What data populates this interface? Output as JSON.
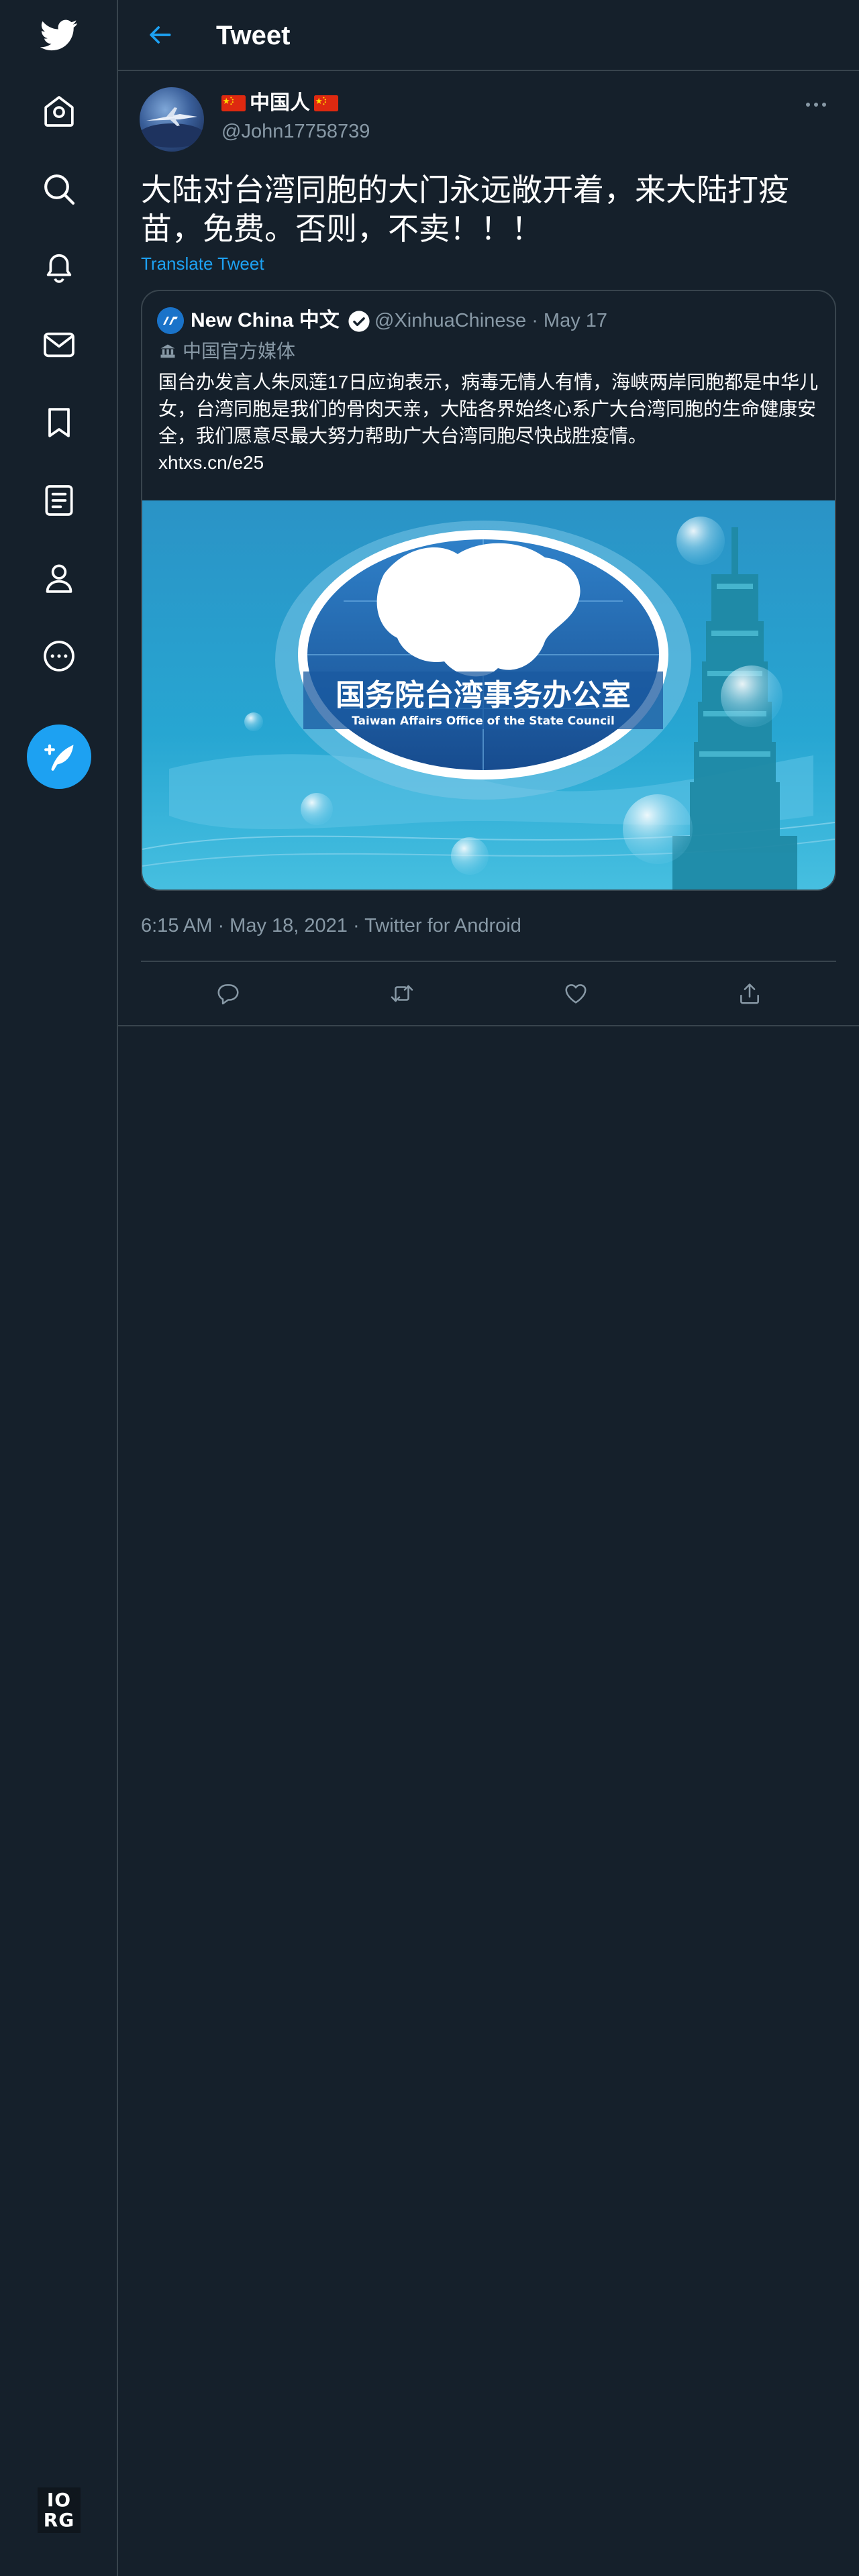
{
  "colors": {
    "background": "#15202b",
    "border": "#38444d",
    "accent": "#1da1f2",
    "secondary_text": "#8899a6",
    "primary_text": "#ffffff"
  },
  "nav": {
    "items": [
      {
        "name": "twitter-logo",
        "icon": "twitter-bird-icon"
      },
      {
        "name": "home",
        "icon": "home-icon"
      },
      {
        "name": "explore",
        "icon": "search-icon"
      },
      {
        "name": "notifications",
        "icon": "bell-icon"
      },
      {
        "name": "messages",
        "icon": "mail-icon"
      },
      {
        "name": "bookmarks",
        "icon": "bookmark-icon"
      },
      {
        "name": "lists",
        "icon": "list-icon"
      },
      {
        "name": "profile",
        "icon": "person-icon"
      },
      {
        "name": "more",
        "icon": "more-circle-icon"
      }
    ],
    "compose_icon": "compose-tweet-icon",
    "watermark_line1": "IO",
    "watermark_line2": "RG"
  },
  "header": {
    "title": "Tweet",
    "back_icon": "arrow-left-icon"
  },
  "tweet": {
    "author": {
      "display_name": "中国人",
      "name_flags": "china-flag-icon",
      "handle": "@John17758739"
    },
    "text": "大陆对台湾同胞的大门永远敞开着，来大陆打疫苗，免费。否则，不卖！！！",
    "translate_label": "Translate Tweet",
    "quoted": {
      "display_name": "New China 中文",
      "verified": true,
      "handle_and_date": "@XinhuaChinese · May 17",
      "label": "中国官方媒体",
      "label_icon": "government-media-icon",
      "text": "国台办发言人朱凤莲17日应询表示，病毒无情人有情，海峡两岸同胞都是中华儿女，台湾同胞是我们的骨肉天亲，大陆各界始终心系广大台湾同胞的生命健康安全，我们愿意尽最大努力帮助广大台湾同胞尽快战胜疫情。",
      "link": "xhtxs.cn/e25",
      "image": {
        "title_cn": "国务院台湾事务办公室",
        "title_en": "Taiwan Affairs Office of the State Council"
      }
    },
    "timestamp": "6:15 AM · May 18, 2021 · Twitter for Android",
    "actions": [
      {
        "name": "reply",
        "icon": "reply-icon"
      },
      {
        "name": "retweet",
        "icon": "retweet-icon"
      },
      {
        "name": "like",
        "icon": "heart-icon"
      },
      {
        "name": "share",
        "icon": "share-icon"
      }
    ]
  }
}
